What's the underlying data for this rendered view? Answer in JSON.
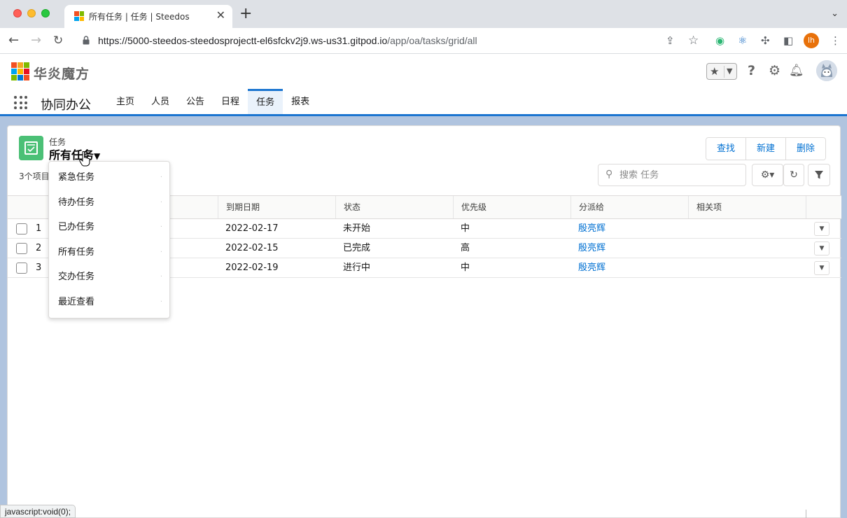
{
  "browser": {
    "tab_title": "所有任务 | 任务 | Steedos",
    "tab_close": "✕",
    "new_tab": "+",
    "url_main": "https://5000-steedos-steedosprojectt-el6sfckv2j9.ws-us31.gitpod.io",
    "url_path": "/app/oa/tasks/grid/all",
    "profile_initials": "lh",
    "status_text": "javascript:void(0);"
  },
  "header": {
    "brand": "华炎魔方",
    "app_name": "协同办公",
    "nav_tabs": [
      "主页",
      "人员",
      "公告",
      "日程",
      "任务",
      "报表"
    ],
    "active_tab": "任务"
  },
  "object": {
    "label": "任务",
    "view_name": "所有任务",
    "item_count": "3个项目",
    "buttons": {
      "find": "查找",
      "new": "新建",
      "delete": "删除"
    },
    "search_placeholder": "搜索 任务"
  },
  "grid": {
    "columns": [
      "到期日期",
      "状态",
      "优先级",
      "分派给",
      "相关项"
    ],
    "rows": [
      {
        "num": "1",
        "due": "2022-02-17",
        "status": "未开始",
        "priority": "中",
        "assignee": "殷亮辉",
        "related": ""
      },
      {
        "num": "2",
        "due": "2022-02-15",
        "status": "已完成",
        "priority": "高",
        "assignee": "殷亮辉",
        "related": ""
      },
      {
        "num": "3",
        "due": "2022-02-19",
        "status": "进行中",
        "priority": "中",
        "assignee": "殷亮辉",
        "related": ""
      }
    ]
  },
  "view_menu": {
    "items": [
      "紧急任务",
      "待办任务",
      "已办任务",
      "所有任务",
      "交办任务",
      "最近查看"
    ]
  },
  "colors": {
    "accent": "#1b75d0",
    "link": "#0070d2",
    "task_icon": "#4bc076"
  }
}
